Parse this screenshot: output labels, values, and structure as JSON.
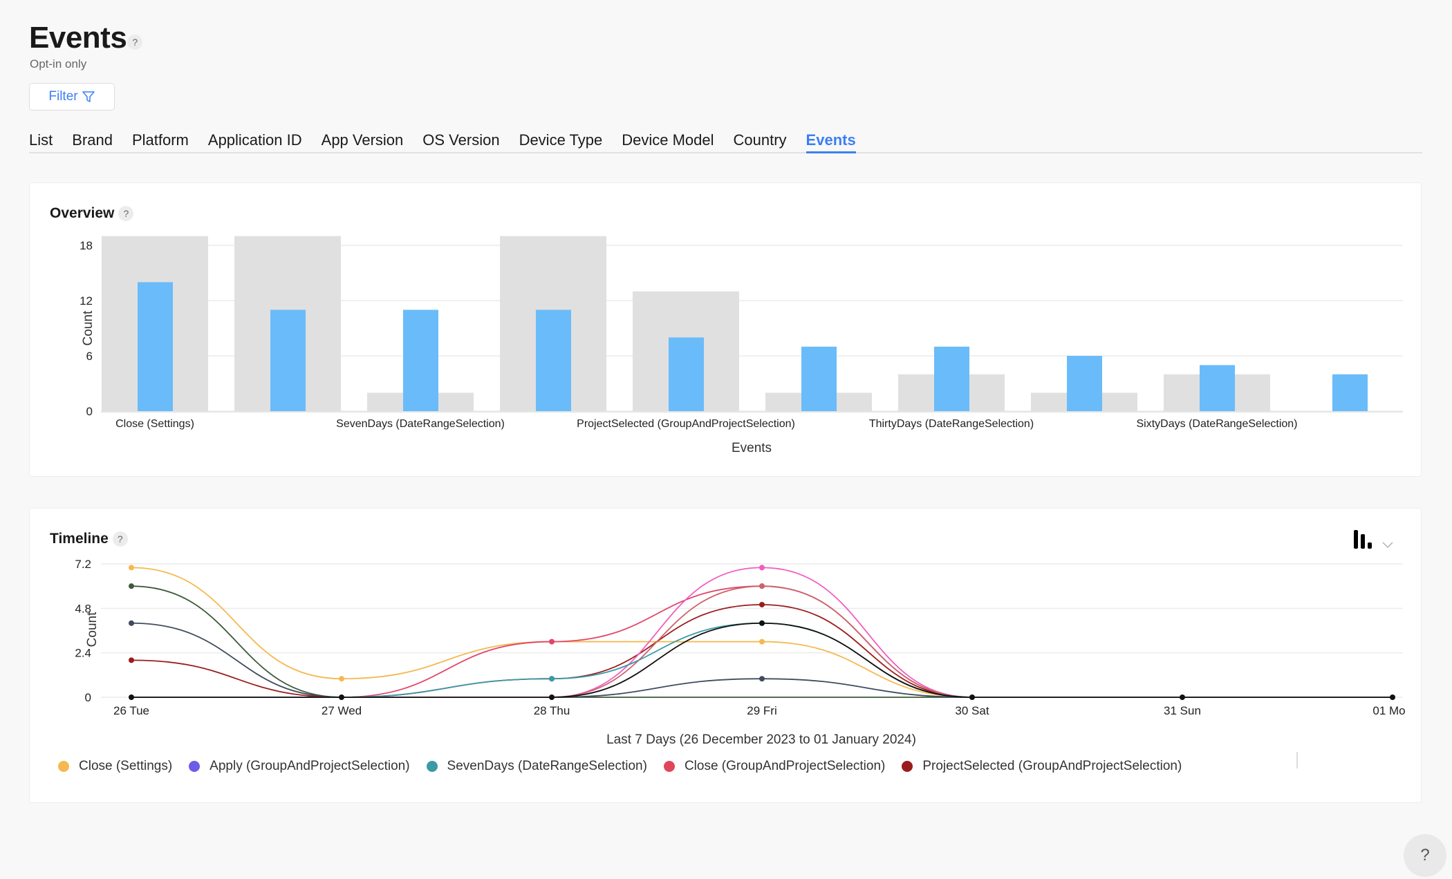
{
  "header": {
    "title": "Events",
    "help": "?",
    "subtitle": "Opt-in only",
    "filter_label": "Filter",
    "filter_icon": "funnel-icon"
  },
  "tabs": [
    {
      "label": "List"
    },
    {
      "label": "Brand"
    },
    {
      "label": "Platform"
    },
    {
      "label": "Application ID"
    },
    {
      "label": "App Version"
    },
    {
      "label": "OS Version"
    },
    {
      "label": "Device Type"
    },
    {
      "label": "Device Model"
    },
    {
      "label": "Country"
    },
    {
      "label": "Events",
      "active": true
    }
  ],
  "colors": {
    "accent": "#3d7ef5",
    "bar_primary": "#6abbf9",
    "bar_background": "#e0e0e0"
  },
  "overview": {
    "title": "Overview",
    "help": "?"
  },
  "timeline": {
    "title": "Timeline",
    "help": "?",
    "chart_type_icon": "bar-chart-icon",
    "dropdown_icon": "chevron-down-icon"
  },
  "help_fab": "?",
  "chart_data": [
    {
      "type": "bar",
      "title": "Overview",
      "xlabel": "Events",
      "ylabel": "Count",
      "ylim": [
        0,
        19
      ],
      "yticks": [
        "0",
        "6",
        "12",
        "18"
      ],
      "grid": true,
      "categories": [
        "Close (Settings)",
        "",
        "SevenDays (DateRangeSelection)",
        "",
        "ProjectSelected (GroupAndProjectSelection)",
        "",
        "ThirtyDays (DateRangeSelection)",
        "",
        "SixtyDays (DateRangeSelection)",
        ""
      ],
      "series": [
        {
          "values": [
            19,
            19,
            2,
            19,
            13,
            2,
            4,
            2,
            4,
            0
          ],
          "color": "#e0e0e0"
        },
        {
          "values": [
            14,
            11,
            11,
            11,
            8,
            7,
            7,
            6,
            5,
            4
          ],
          "color": "#6abbf9"
        }
      ]
    },
    {
      "type": "line",
      "title": "Timeline",
      "xlabel": "Last 7 Days (26 December 2023 to 01 January 2024)",
      "ylabel": "Count",
      "ylim": [
        0,
        7.2
      ],
      "yticks": [
        "0",
        "2.4",
        "4.8",
        "7.2"
      ],
      "grid": true,
      "x": [
        "26 Tue",
        "27 Wed",
        "28 Thu",
        "29 Fri",
        "30 Sat",
        "31 Sun",
        "01 Mo"
      ],
      "series": [
        {
          "values": [
            7,
            1,
            3,
            3,
            0,
            0,
            0
          ],
          "color": "#f5b94f"
        },
        {
          "values": [
            6,
            0,
            0,
            0,
            0,
            0,
            0
          ],
          "color": "#3d5a3a"
        },
        {
          "values": [
            4,
            0,
            0,
            1,
            0,
            0,
            0
          ],
          "color": "#3f4b5e"
        },
        {
          "values": [
            2,
            0,
            1,
            5,
            0,
            0,
            0
          ],
          "color": "#9b1c1c"
        },
        {
          "values": [
            0,
            0,
            3,
            6,
            0,
            0,
            0
          ],
          "color": "#e0466a"
        },
        {
          "values": [
            0,
            0,
            0,
            7,
            0,
            0,
            0
          ],
          "color": "#f25cbf"
        },
        {
          "values": [
            0,
            0,
            0,
            6,
            0,
            0,
            0
          ],
          "color": "#c9646e"
        },
        {
          "values": [
            0,
            0,
            1,
            4,
            0,
            0,
            0
          ],
          "color": "#3a9aa6"
        },
        {
          "values": [
            0,
            0,
            0,
            4,
            0,
            0,
            0
          ],
          "color": "#111111"
        }
      ],
      "legend": [
        {
          "name": "Close (Settings)",
          "color": "#f5b94f"
        },
        {
          "name": "Apply (GroupAndProjectSelection)",
          "color": "#6c5ce7"
        },
        {
          "name": "SevenDays (DateRangeSelection)",
          "color": "#3a9aa6"
        },
        {
          "name": "Close (GroupAndProjectSelection)",
          "color": "#e0465a"
        },
        {
          "name": "ProjectSelected (GroupAndProjectSelection)",
          "color": "#9b1c1c"
        }
      ],
      "legend_position": "bottom"
    }
  ]
}
